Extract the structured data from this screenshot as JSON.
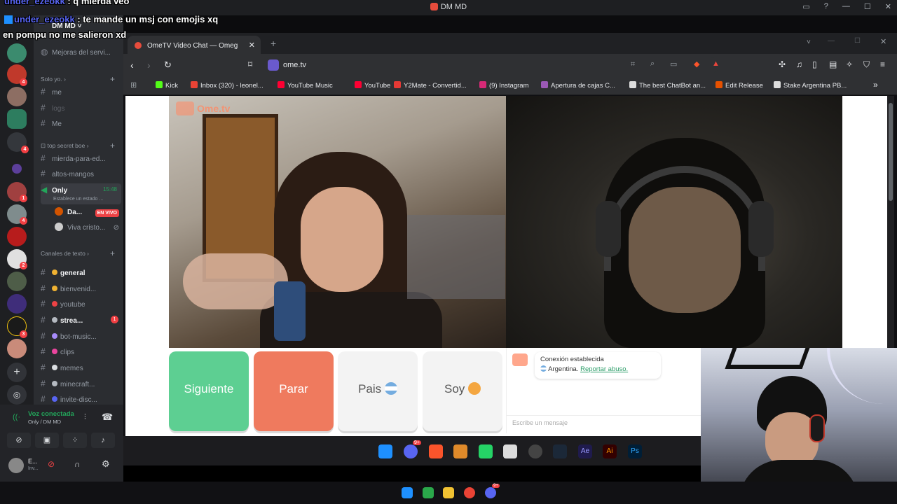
{
  "window": {
    "title": "DM MD"
  },
  "overlay": {
    "line1_user": "under_ezeokk",
    "line1_text": ": q mierda veo",
    "line2_user": "under_ezeokk",
    "line2_text": ": te mande un msj con emojis xq",
    "line3_text": "en pompu no me salieron xd"
  },
  "discord": {
    "server_name": "DM MD",
    "events": "Mejoras del servi...",
    "cat_solo": "Solo yo.",
    "ch_me": "me",
    "ch_logs": "logs",
    "ch_Me": "Me",
    "cat_secret": "top secret boe",
    "ch_mierda": "mierda-para-ed...",
    "ch_altos": "altos-mangos",
    "voice_only": "Only",
    "voice_only_time": "15:48",
    "voice_only_status": "Establece un estado ...",
    "voice_user1": "Da...",
    "live_badge": "EN VIVO",
    "voice_user2": "Viva cristo...",
    "cat_text": "Canales de texto",
    "text_channels": [
      {
        "name": "general",
        "icon": "note-icon",
        "color": "#f0b232"
      },
      {
        "name": "bienvenid...",
        "icon": "sun-icon",
        "color": "#f0b232"
      },
      {
        "name": "youtube",
        "icon": "red-dot-icon",
        "color": "#ed4245"
      },
      {
        "name": "strea...",
        "icon": "cam-icon",
        "color": "#b5bac1",
        "badge": "1"
      },
      {
        "name": "bot-music...",
        "icon": "music-icon",
        "color": "#a78bfa"
      },
      {
        "name": "clips",
        "icon": "clip-icon",
        "color": "#eb459e"
      },
      {
        "name": "memes",
        "icon": "memes-icon",
        "color": "#dbdee1"
      },
      {
        "name": "minecraft...",
        "icon": "pickaxe-icon",
        "color": "#b5bac1"
      },
      {
        "name": "invite-disc...",
        "icon": "shield-icon",
        "color": "#5865f2"
      }
    ],
    "voice_connected": "Voz conectada",
    "voice_connected_sub": "Only / DM MD",
    "user_name": "E...",
    "user_status": "Inv..."
  },
  "browser": {
    "tab_title": "OmeTV Video Chat — Omeg",
    "url": "ome.tv",
    "bookmarks": [
      {
        "label": "Kick",
        "color": "#53fc18"
      },
      {
        "label": "Inbox (320) - leonel...",
        "color": "#ea4335"
      },
      {
        "label": "YouTube Music",
        "color": "#ff0033"
      },
      {
        "label": "YouTube",
        "color": "#ff0033"
      },
      {
        "label": "Y2Mate - Convertid...",
        "color": "#e53935"
      },
      {
        "label": "(9) Instagram",
        "color": "#d62976"
      },
      {
        "label": "Apertura de cajas C...",
        "color": "#9b59b6"
      },
      {
        "label": "The best ChatBot an...",
        "color": "#dddddd"
      },
      {
        "label": "Edit Release",
        "color": "#e65100"
      },
      {
        "label": "Stake Argentina PB...",
        "color": "#dddddd"
      }
    ]
  },
  "ometv": {
    "logo": "Ome.tv",
    "btn_next": "Siguiente",
    "btn_stop": "Parar",
    "btn_country": "Pais",
    "btn_gender": "Soy",
    "status_line1": "Conexión establecida",
    "status_country": "Argentina.",
    "report_link": "Reportar abuso.",
    "input_placeholder": "Escribe un mensaje",
    "colors": {
      "next": "#5dcf92",
      "stop": "#ef7a5e",
      "neutral": "#f3f3f3"
    }
  },
  "badges": {
    "discord_inner": "9+",
    "discord_taskbar": "9+"
  }
}
